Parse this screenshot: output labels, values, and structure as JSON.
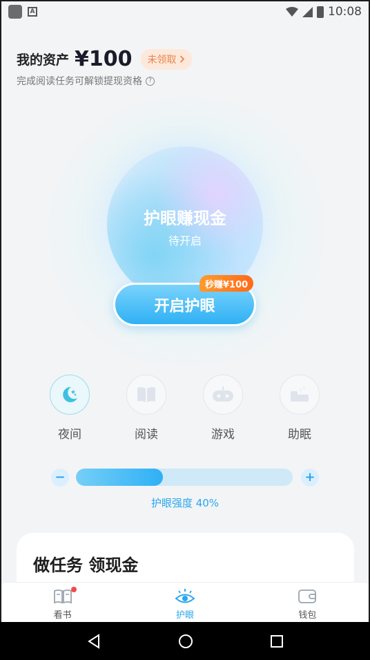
{
  "status_bar": {
    "time": "10:08"
  },
  "header": {
    "assets_label": "我的资产",
    "assets_value": "¥100",
    "claim_badge": "未领取",
    "subtitle": "完成阅读任务可解锁提现资格"
  },
  "orb": {
    "title": "护眼赚现金",
    "status": "待开启"
  },
  "start_button": {
    "label": "开启护眼",
    "promo_tag": "秒赚¥100"
  },
  "modes": [
    {
      "label": "夜间",
      "icon": "moon-stars-icon",
      "active": true
    },
    {
      "label": "阅读",
      "icon": "book-icon",
      "active": false
    },
    {
      "label": "游戏",
      "icon": "gamepad-icon",
      "active": false
    },
    {
      "label": "助眠",
      "icon": "bed-icon",
      "active": false
    }
  ],
  "intensity": {
    "minus": "−",
    "plus": "+",
    "percent": 40,
    "label": "护眼强度 40%"
  },
  "task_card": {
    "title": "做任务 领现金"
  },
  "bottom_nav": [
    {
      "label": "看书",
      "icon": "book-open-icon",
      "active": false,
      "badge": true
    },
    {
      "label": "护眼",
      "icon": "eye-icon",
      "active": true,
      "badge": false
    },
    {
      "label": "钱包",
      "icon": "wallet-icon",
      "active": false,
      "badge": false
    }
  ],
  "colors": {
    "accent": "#2aa7ec",
    "promo": "#ff7a22",
    "badge_bg": "#fde9dc",
    "badge_text": "#e8834a"
  }
}
